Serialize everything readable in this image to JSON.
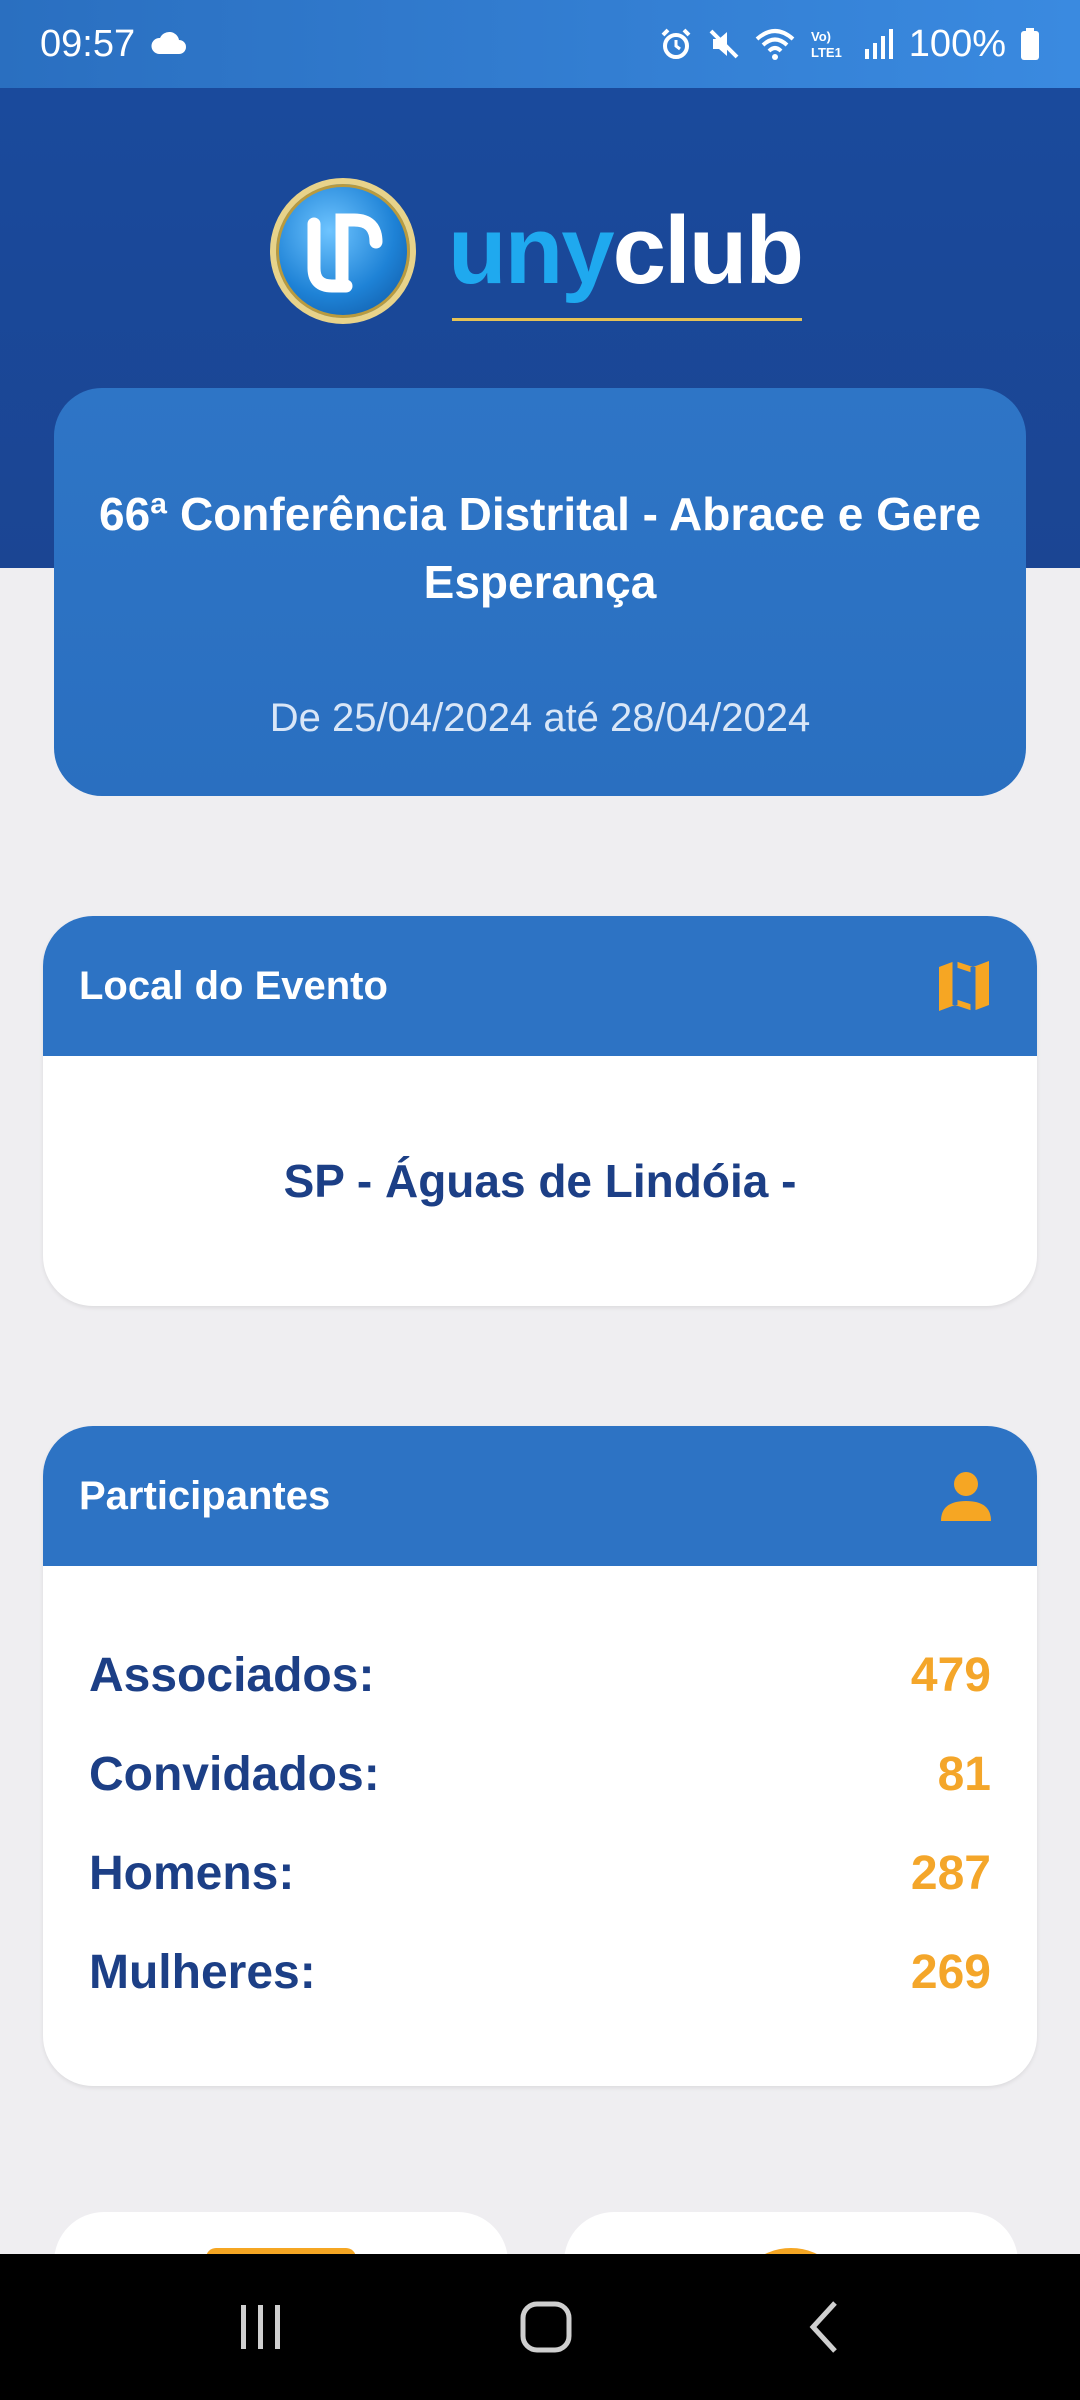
{
  "status_bar": {
    "time": "09:57",
    "battery": "100%",
    "icons": [
      "cloud-icon",
      "alarm-icon",
      "mute-icon",
      "wifi-icon",
      "volte-icon",
      "signal-icon",
      "battery-icon"
    ]
  },
  "brand": {
    "name_part1": "uny",
    "name_part2": "club",
    "accent_colors": {
      "primary": "#2d73c4",
      "dark": "#1b4593",
      "highlight": "#f4a62a"
    }
  },
  "event": {
    "title": "66ª Conferência Distrital - Abrace e Gere Esperança",
    "dates": "De 25/04/2024 até 28/04/2024"
  },
  "location_section": {
    "title": "Local do Evento",
    "icon": "map-icon",
    "value": "SP - Águas de Lindóia -"
  },
  "participants_section": {
    "title": "Participantes",
    "icon": "person-icon",
    "rows": [
      {
        "label": "Associados:",
        "value": "479"
      },
      {
        "label": "Convidados:",
        "value": "81"
      },
      {
        "label": "Homens:",
        "value": "287"
      },
      {
        "label": "Mulheres:",
        "value": "269"
      }
    ]
  },
  "nav_bar": {
    "buttons": [
      "recent-apps-button",
      "home-button",
      "back-button"
    ]
  }
}
